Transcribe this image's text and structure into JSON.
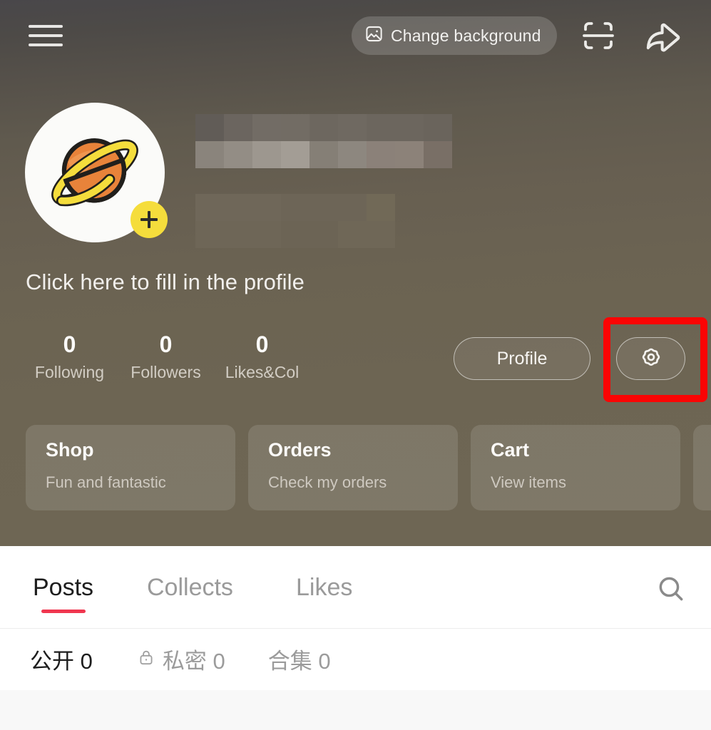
{
  "header": {
    "menu_icon": "hamburger-menu-icon",
    "change_background": {
      "label": "Change background",
      "icon": "image-picture-icon"
    },
    "scan_icon": "scan-qr-icon",
    "share_icon": "share-arrow-icon"
  },
  "profile": {
    "avatar_icon": "saturn-planet-avatar",
    "add_badge_icon": "plus-badge-icon",
    "name_redacted": true,
    "fill_profile_hint": "Click here to fill in the profile",
    "stats": [
      {
        "value": "0",
        "label": "Following"
      },
      {
        "value": "0",
        "label": "Followers"
      },
      {
        "value": "0",
        "label": "Likes&Col"
      }
    ],
    "profile_button": "Profile",
    "settings_icon": "gear-settings-icon"
  },
  "quick_cards": [
    {
      "title": "Shop",
      "subtitle": "Fun and fantastic"
    },
    {
      "title": "Orders",
      "subtitle": "Check my orders"
    },
    {
      "title": "Cart",
      "subtitle": "View items"
    },
    {
      "title": "",
      "subtitle": ""
    }
  ],
  "tabs": [
    {
      "label": "Posts",
      "active": true
    },
    {
      "label": "Collects",
      "active": false
    },
    {
      "label": "Likes",
      "active": false
    }
  ],
  "search_icon": "search-magnifier-icon",
  "subfilters": [
    {
      "label": "公开 0",
      "icon": null,
      "active": true
    },
    {
      "label": "私密 0",
      "icon": "lock-icon",
      "active": false
    },
    {
      "label": "合集 0",
      "icon": null,
      "active": false
    }
  ],
  "colors": {
    "cover_top": "#49474a",
    "cover_bottom": "#6e6654",
    "accent_tab_underline": "#f0364f",
    "highlight_annotation": "#fb0404",
    "avatar_badge": "#f5dd3c",
    "avatar_planet_body": "#e8833a",
    "avatar_planet_ring": "#f5dd3c",
    "content_background": "#ffffff",
    "page_background": "#f8f8f8"
  }
}
